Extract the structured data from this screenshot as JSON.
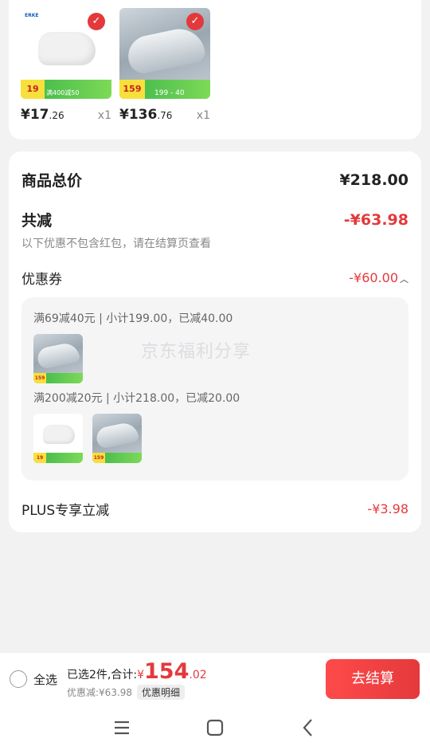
{
  "products": [
    {
      "brand": "ERKE",
      "price_int": "¥17",
      "price_dec": ".26",
      "qty": "x1",
      "promo_price": "19",
      "promo_text": "满400减50"
    },
    {
      "brand": "",
      "price_int": "¥136",
      "price_dec": ".76",
      "qty": "x1",
      "promo_price": "159",
      "promo_text": "199 - 40"
    }
  ],
  "summary": {
    "total_label": "商品总价",
    "total_value": "¥218.00",
    "reduce_label": "共减",
    "reduce_value": "-¥63.98",
    "reduce_note": "以下优惠不包含红包，请在结算页查看",
    "coupon_label": "优惠券",
    "coupon_value": "-¥60.00",
    "coupon_line1": "满69减40元 | 小计199.00，已减40.00",
    "coupon_line2": "满200减20元 | 小计218.00，已减20.00",
    "watermark": "京东福利分享",
    "plus_label": "PLUS专享立减",
    "plus_value": "-¥3.98"
  },
  "thumbs": {
    "shoe_promo": "159",
    "sock_promo": "19"
  },
  "bottom_bar": {
    "select_all": "全选",
    "selected_text": "已选2件,合计:",
    "currency": "¥",
    "total_int": "154",
    "total_dec": ".02",
    "discount_text": "优惠减:¥63.98",
    "detail_label": "优惠明细",
    "checkout_label": "去结算"
  },
  "colors": {
    "accent": "#e4393c",
    "promo_green": "#39b54a"
  },
  "icons": [
    "check-icon",
    "chevron-up-icon",
    "menu-icon",
    "home-icon",
    "back-icon"
  ]
}
